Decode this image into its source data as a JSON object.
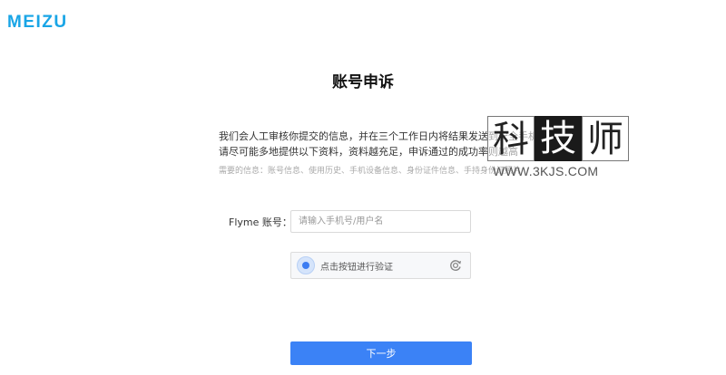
{
  "header": {
    "logo": "MEIZU"
  },
  "main": {
    "title": "账号申诉",
    "description_line1": "我们会人工审核你提交的信息，并在三个工作日内将结果发送到安全手机",
    "description_line2": "请尽可能多地提供以下资料，资料越充足，申诉通过的成功率则越高",
    "hint": "需要的信息：账号信息、使用历史、手机设备信息、身份证件信息、手持身份证照片"
  },
  "form": {
    "account_label": "Flyme 账号：",
    "account_placeholder": "请输入手机号/用户名",
    "captcha_text": "点击按钮进行验证",
    "next_label": "下一步"
  },
  "watermark": {
    "chars": [
      "科",
      "技",
      "师"
    ],
    "url": "WWW.3KJS.COM"
  },
  "colors": {
    "brand": "#19a5e6",
    "primary_button": "#3b82f6"
  },
  "icons": {
    "captcha": "captcha-dot-icon",
    "refresh": "refresh-icon"
  }
}
